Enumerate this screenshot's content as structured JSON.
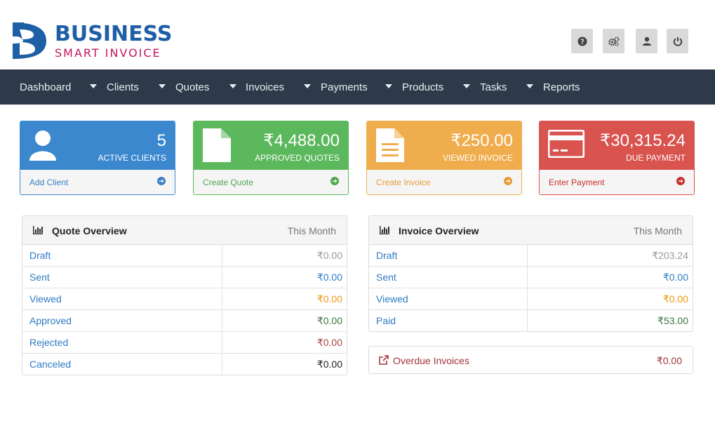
{
  "brand": {
    "title": "BUSINESS",
    "subtitle": "SMART INVOICE"
  },
  "header_buttons": [
    {
      "icon": "help-icon"
    },
    {
      "icon": "settings-icon"
    },
    {
      "icon": "user-icon"
    },
    {
      "icon": "power-icon"
    }
  ],
  "nav": {
    "items": [
      "Dashboard",
      "Clients",
      "Quotes",
      "Invoices",
      "Payments",
      "Products",
      "Tasks",
      "Reports"
    ]
  },
  "cards": [
    {
      "value": "5",
      "label": "ACTIVE CLIENTS",
      "link": "Add Client",
      "icon": "user-icon",
      "color": "#3b88cf",
      "link_color": "#3b7fc4"
    },
    {
      "value": "₹4,488.00",
      "label": "APPROVED QUOTES",
      "link": "Create Quote",
      "icon": "document-icon",
      "color": "#5cb85c",
      "link_color": "#4fa64f"
    },
    {
      "value": "₹250.00",
      "label": "VIEWED INVOICE",
      "link": "Create Invoice",
      "icon": "invoice-icon",
      "color": "#f0ad4e",
      "link_color": "#e99a35"
    },
    {
      "value": "₹30,315.24",
      "label": "DUE PAYMENT",
      "link": "Enter Payment",
      "icon": "credit-card-icon",
      "color": "#d9534f",
      "link_color": "#c9302c"
    }
  ],
  "quote_overview": {
    "title": "Quote Overview",
    "period": "This Month",
    "rows": [
      {
        "name": "Draft",
        "amount": "₹0.00",
        "color": "#999999"
      },
      {
        "name": "Sent",
        "amount": "₹0.00",
        "color": "#2e7bc4"
      },
      {
        "name": "Viewed",
        "amount": "₹0.00",
        "color": "#f0960e"
      },
      {
        "name": "Approved",
        "amount": "₹0.00",
        "color": "#3c763d"
      },
      {
        "name": "Rejected",
        "amount": "₹0.00",
        "color": "#a94442"
      },
      {
        "name": "Canceled",
        "amount": "₹0.00",
        "color": "#222222"
      }
    ]
  },
  "invoice_overview": {
    "title": "Invoice Overview",
    "period": "This Month",
    "rows": [
      {
        "name": "Draft",
        "amount": "₹203.24",
        "color": "#999999"
      },
      {
        "name": "Sent",
        "amount": "₹0.00",
        "color": "#2e7bc4"
      },
      {
        "name": "Viewed",
        "amount": "₹0.00",
        "color": "#f0960e"
      },
      {
        "name": "Paid",
        "amount": "₹53.00",
        "color": "#3c763d"
      }
    ]
  },
  "overdue": {
    "label": "Overdue Invoices",
    "amount": "₹0.00"
  }
}
